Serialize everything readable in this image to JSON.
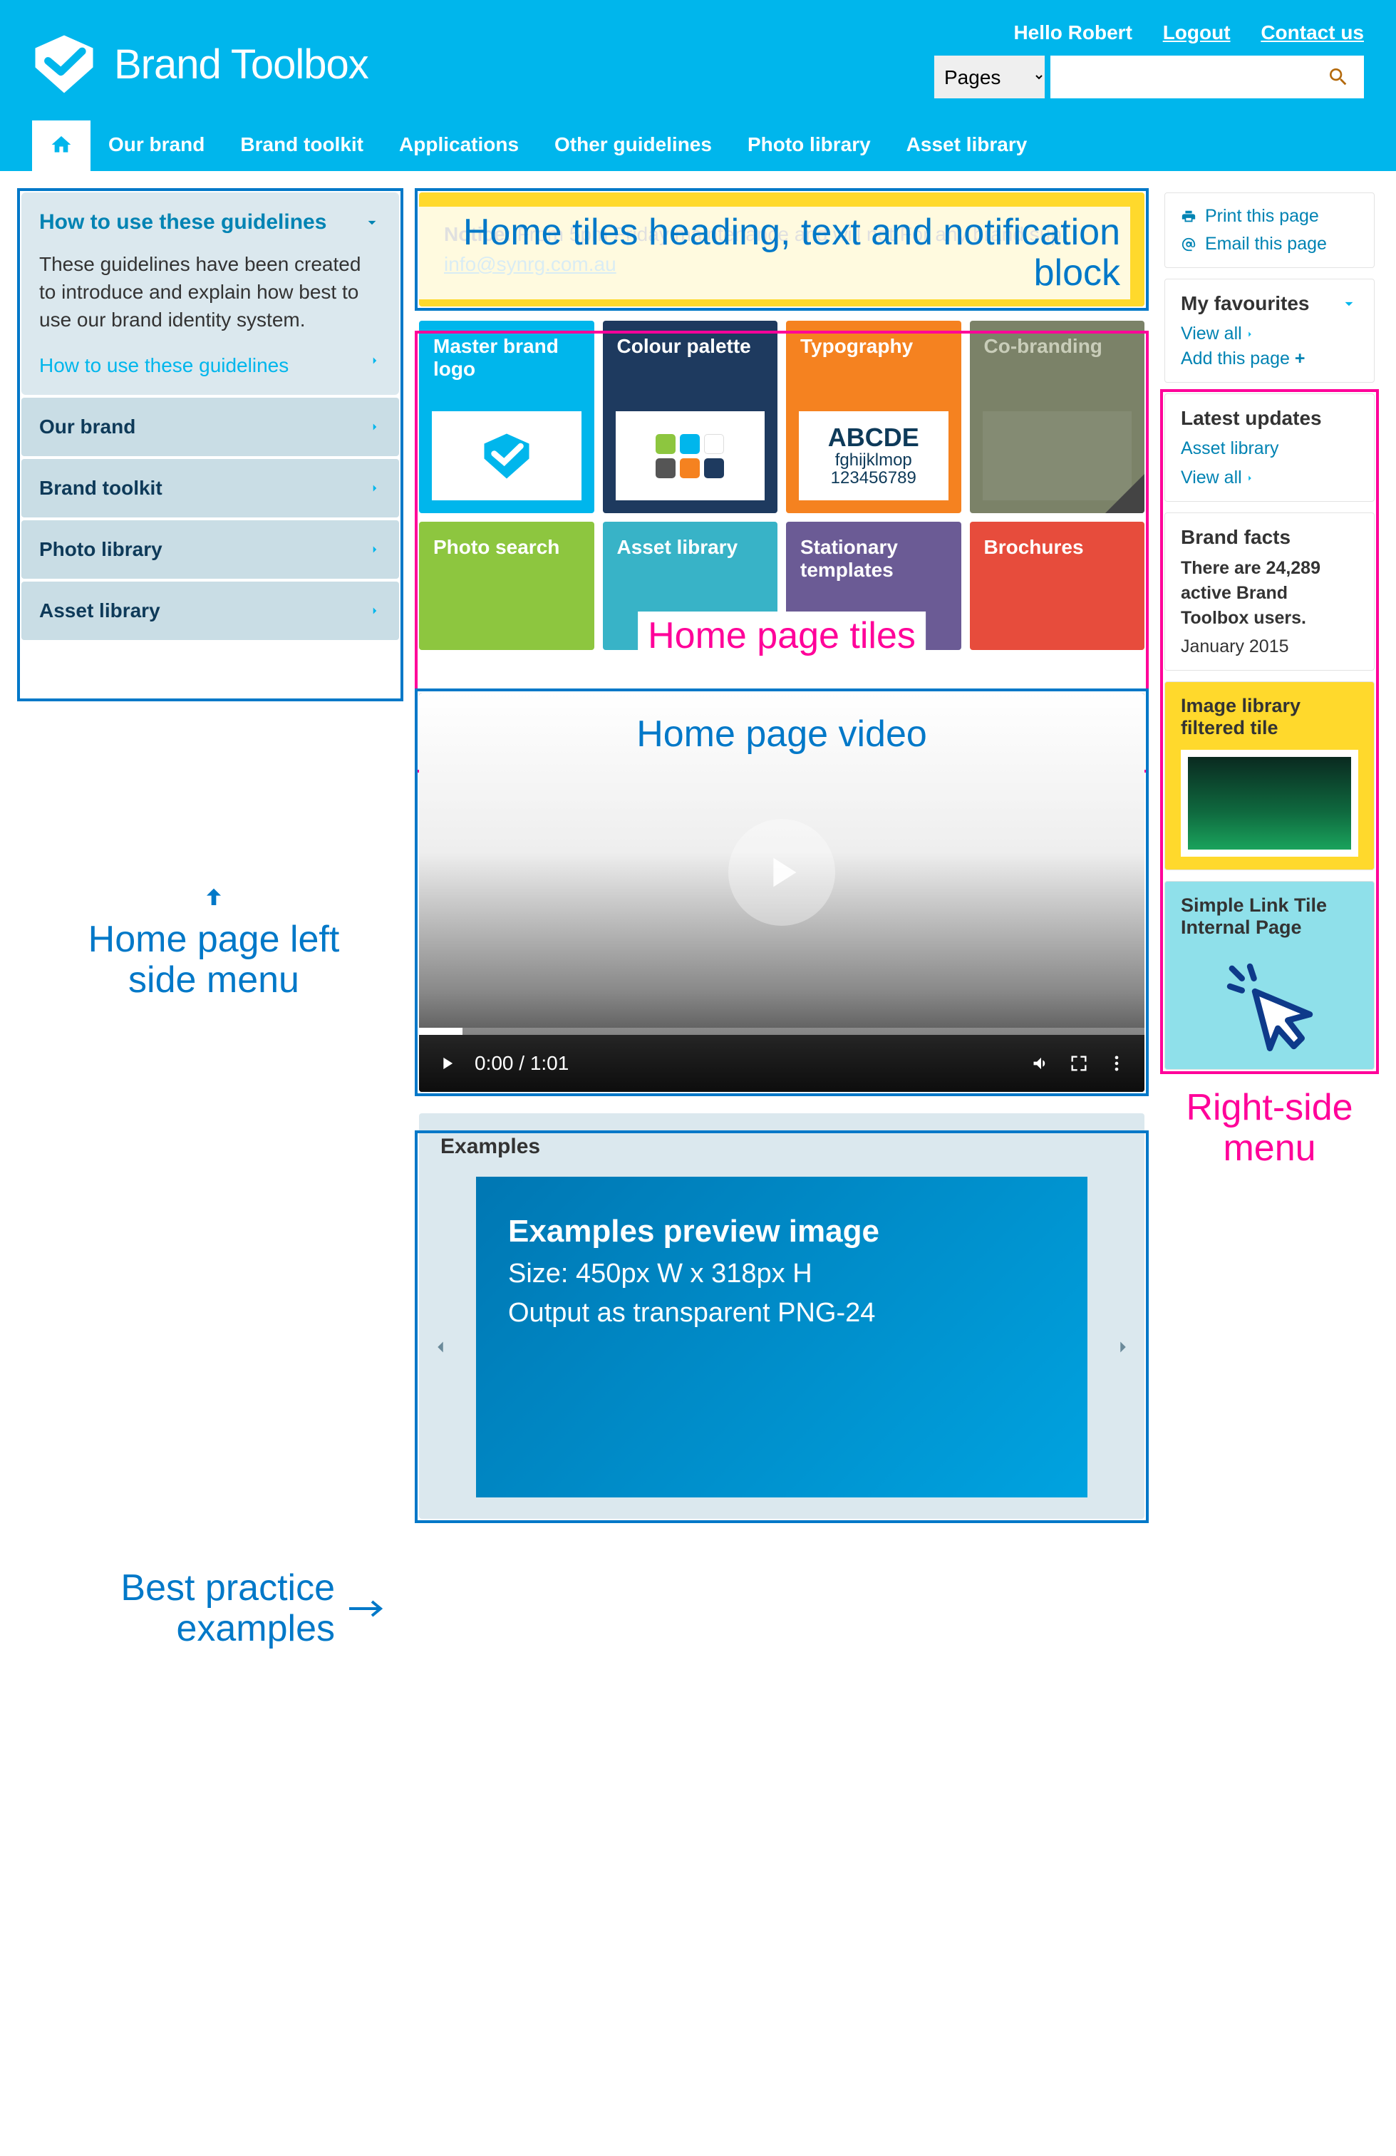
{
  "colors": {
    "brand": "#00b6ec",
    "annot_pink": "#ff0099",
    "annot_blue": "#0078c8"
  },
  "header": {
    "greeting": "Hello Robert",
    "logout": "Logout",
    "contact": "Contact us",
    "search_scope": "Pages",
    "brand": "Brand Toolbox"
  },
  "nav": [
    "Our brand",
    "Brand toolkit",
    "Applications",
    "Other guidelines",
    "Photo library",
    "Asset library"
  ],
  "sidebar": {
    "title": "How to use these guidelines",
    "intro": "These guidelines have been created to introduce and explain how best to use our brand identity system.",
    "link": "How to use these guidelines",
    "items": [
      "Our brand",
      "Brand toolkit",
      "Photo library",
      "Asset library"
    ]
  },
  "notice": {
    "label": "Notice:",
    "text": " From 5pm Friday maintenance and will not For any brand sup",
    "email": "info@synrg.com.au"
  },
  "tiles_row1": [
    {
      "label": "Master brand logo",
      "cls": "t-blue"
    },
    {
      "label": "Colour palette",
      "cls": "t-navy"
    },
    {
      "label": "Typography",
      "cls": "t-orange",
      "typo": true
    },
    {
      "label": "Co-branding",
      "cls": "t-olive",
      "locked": true
    }
  ],
  "tiles_row2": [
    {
      "label": "Photo search",
      "cls": "t-green"
    },
    {
      "label": "Asset library",
      "cls": "t-teal"
    },
    {
      "label": "Stationary templates",
      "cls": "t-purple"
    },
    {
      "label": "Brochures",
      "cls": "t-red"
    }
  ],
  "typo_sample": {
    "l1": "ABCDE",
    "l2": "fghijklmop",
    "l3": "123456789"
  },
  "video": {
    "time": "0:00 / 1:01"
  },
  "examples": {
    "heading": "Examples",
    "l1": "Examples preview image",
    "l2": "Size: 450px W x 318px H",
    "l3": "Output as transparent PNG-24"
  },
  "right": {
    "print": "Print this page",
    "email": "Email this page",
    "fav_head": "My favourites",
    "viewall": "View all",
    "addpage": "Add this page",
    "latest_head": "Latest updates",
    "latest_link": "Asset library",
    "facts_head": "Brand facts",
    "facts_body": "There are 24,289 active Brand Toolbox users.",
    "facts_date": "January 2015",
    "yellow": "Image library filtered tile",
    "cyan": "Simple Link Tile Internal Page"
  },
  "annotations": {
    "a1": "Home tiles heading, text and notification block",
    "a2": "Home page tiles",
    "a3": "Home page left side menu",
    "a4": "Home page video",
    "a5": "Best practice examples",
    "a6": "Right-side menu"
  }
}
